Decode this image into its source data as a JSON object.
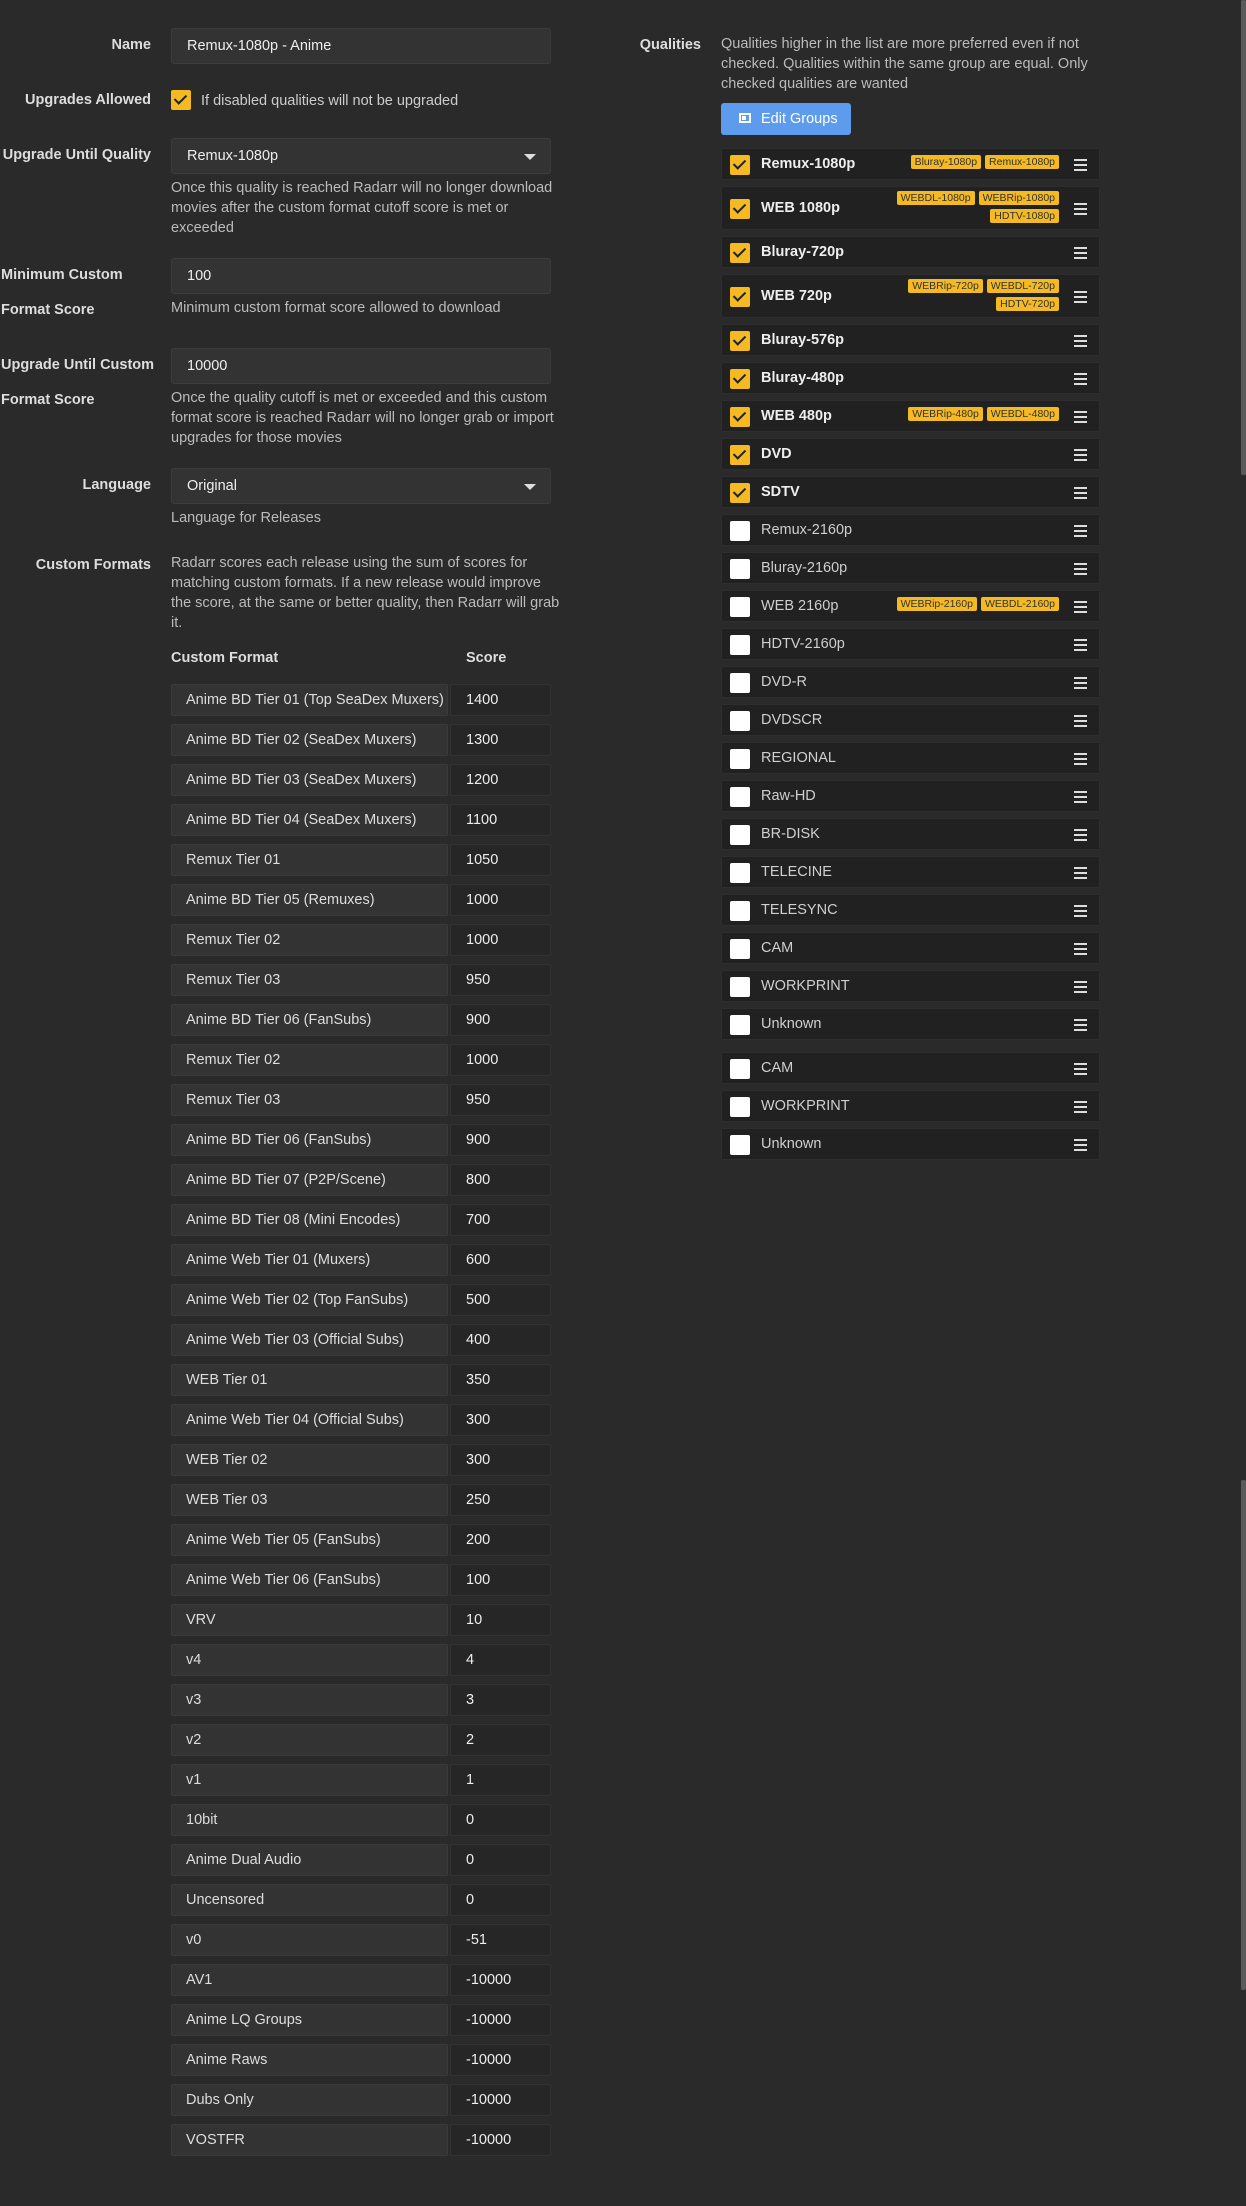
{
  "form": {
    "name_label": "Name",
    "name_value": "Remux-1080p - Anime",
    "upgrades_label": "Upgrades Allowed",
    "upgrades_help": "If disabled qualities will not be upgraded",
    "until_quality_label": "Upgrade Until Quality",
    "until_quality_value": "Remux-1080p",
    "until_quality_help": "Once this quality is reached Radarr will no longer download movies after the custom format cutoff score is met or exceeded",
    "min_score_label_1": "Minimum Custom",
    "min_score_label_2": "Format Score",
    "min_score_value": "100",
    "min_score_help": "Minimum custom format score allowed to download",
    "until_score_label_1": "Upgrade Until Custom",
    "until_score_label_2": "Format Score",
    "until_score_value": "10000",
    "until_score_help": "Once the quality cutoff is met or exceeded and this custom format score is reached Radarr will no longer grab or import upgrades for those movies",
    "language_label": "Language",
    "language_value": "Original",
    "language_help": "Language for Releases",
    "custom_formats_label": "Custom Formats",
    "custom_formats_help": "Radarr scores each release using the sum of scores for matching custom formats. If a new release would improve the score, at the same or better quality, then Radarr will grab it."
  },
  "custom_formats": {
    "col_format": "Custom Format",
    "col_score": "Score",
    "rows": [
      {
        "name": "Anime BD Tier 01 (Top SeaDex Muxers)",
        "score": "1400"
      },
      {
        "name": "Anime BD Tier 02 (SeaDex Muxers)",
        "score": "1300"
      },
      {
        "name": "Anime BD Tier 03 (SeaDex Muxers)",
        "score": "1200"
      },
      {
        "name": "Anime BD Tier 04 (SeaDex Muxers)",
        "score": "1100"
      },
      {
        "name": "Remux Tier 01",
        "score": "1050"
      },
      {
        "name": "Anime BD Tier 05 (Remuxes)",
        "score": "1000"
      },
      {
        "name": "Remux Tier 02",
        "score": "1000"
      },
      {
        "name": "Remux Tier 03",
        "score": "950"
      },
      {
        "name": "Anime BD Tier 06 (FanSubs)",
        "score": "900"
      },
      {
        "name": "Remux Tier 02",
        "score": "1000"
      },
      {
        "name": "Remux Tier 03",
        "score": "950"
      },
      {
        "name": "Anime BD Tier 06 (FanSubs)",
        "score": "900"
      },
      {
        "name": "Anime BD Tier 07 (P2P/Scene)",
        "score": "800"
      },
      {
        "name": "Anime BD Tier 08 (Mini Encodes)",
        "score": "700"
      },
      {
        "name": "Anime Web Tier 01 (Muxers)",
        "score": "600"
      },
      {
        "name": "Anime Web Tier 02 (Top FanSubs)",
        "score": "500"
      },
      {
        "name": "Anime Web Tier 03 (Official Subs)",
        "score": "400"
      },
      {
        "name": "WEB Tier 01",
        "score": "350"
      },
      {
        "name": "Anime Web Tier 04 (Official Subs)",
        "score": "300"
      },
      {
        "name": "WEB Tier 02",
        "score": "300"
      },
      {
        "name": "WEB Tier 03",
        "score": "250"
      },
      {
        "name": "Anime Web Tier 05 (FanSubs)",
        "score": "200"
      },
      {
        "name": "Anime Web Tier 06 (FanSubs)",
        "score": "100"
      },
      {
        "name": "VRV",
        "score": "10"
      },
      {
        "name": "v4",
        "score": "4"
      },
      {
        "name": "v3",
        "score": "3"
      },
      {
        "name": "v2",
        "score": "2"
      },
      {
        "name": "v1",
        "score": "1"
      },
      {
        "name": "10bit",
        "score": "0"
      },
      {
        "name": "Anime Dual Audio",
        "score": "0"
      },
      {
        "name": "Uncensored",
        "score": "0"
      },
      {
        "name": "v0",
        "score": "-51"
      },
      {
        "name": "AV1",
        "score": "-10000"
      },
      {
        "name": "Anime LQ Groups",
        "score": "-10000"
      },
      {
        "name": "Anime Raws",
        "score": "-10000"
      },
      {
        "name": "Dubs Only",
        "score": "-10000"
      },
      {
        "name": "VOSTFR",
        "score": "-10000"
      }
    ]
  },
  "qualities": {
    "label": "Qualities",
    "help": "Qualities higher in the list are more preferred even if not checked. Qualities within the same group are equal. Only checked qualities are wanted",
    "edit_groups_label": "Edit Groups",
    "items": [
      {
        "name": "Remux-1080p",
        "checked": true,
        "tags": [
          "Bluray-1080p",
          "Remux-1080p"
        ]
      },
      {
        "name": "WEB 1080p",
        "checked": true,
        "tags": [
          "WEBDL-1080p",
          "WEBRip-1080p",
          "HDTV-1080p"
        ]
      },
      {
        "name": "Bluray-720p",
        "checked": true,
        "tags": []
      },
      {
        "name": "WEB 720p",
        "checked": true,
        "tags": [
          "WEBRip-720p",
          "WEBDL-720p",
          "HDTV-720p"
        ]
      },
      {
        "name": "Bluray-576p",
        "checked": true,
        "tags": []
      },
      {
        "name": "Bluray-480p",
        "checked": true,
        "tags": []
      },
      {
        "name": "WEB 480p",
        "checked": true,
        "tags": [
          "WEBRip-480p",
          "WEBDL-480p"
        ]
      },
      {
        "name": "DVD",
        "checked": true,
        "tags": []
      },
      {
        "name": "SDTV",
        "checked": true,
        "tags": []
      },
      {
        "name": "Remux-2160p",
        "checked": false,
        "tags": []
      },
      {
        "name": "Bluray-2160p",
        "checked": false,
        "tags": []
      },
      {
        "name": "WEB 2160p",
        "checked": false,
        "tags": [
          "WEBRip-2160p",
          "WEBDL-2160p"
        ]
      },
      {
        "name": "HDTV-2160p",
        "checked": false,
        "tags": []
      },
      {
        "name": "DVD-R",
        "checked": false,
        "tags": []
      },
      {
        "name": "DVDSCR",
        "checked": false,
        "tags": []
      },
      {
        "name": "REGIONAL",
        "checked": false,
        "tags": []
      },
      {
        "name": "Raw-HD",
        "checked": false,
        "tags": []
      },
      {
        "name": "BR-DISK",
        "checked": false,
        "tags": []
      },
      {
        "name": "TELECINE",
        "checked": false,
        "tags": []
      },
      {
        "name": "TELESYNC",
        "checked": false,
        "tags": []
      },
      {
        "name": "CAM",
        "checked": false,
        "tags": []
      },
      {
        "name": "WORKPRINT",
        "checked": false,
        "tags": []
      },
      {
        "name": "Unknown",
        "checked": false,
        "tags": []
      },
      {
        "name": "CAM",
        "checked": false,
        "tags": []
      },
      {
        "name": "WORKPRINT",
        "checked": false,
        "tags": []
      },
      {
        "name": "Unknown",
        "checked": false,
        "tags": []
      }
    ]
  },
  "colors": {
    "background": "#2a2a2a",
    "accent": "#f5b922",
    "button": "#5d9cec"
  }
}
